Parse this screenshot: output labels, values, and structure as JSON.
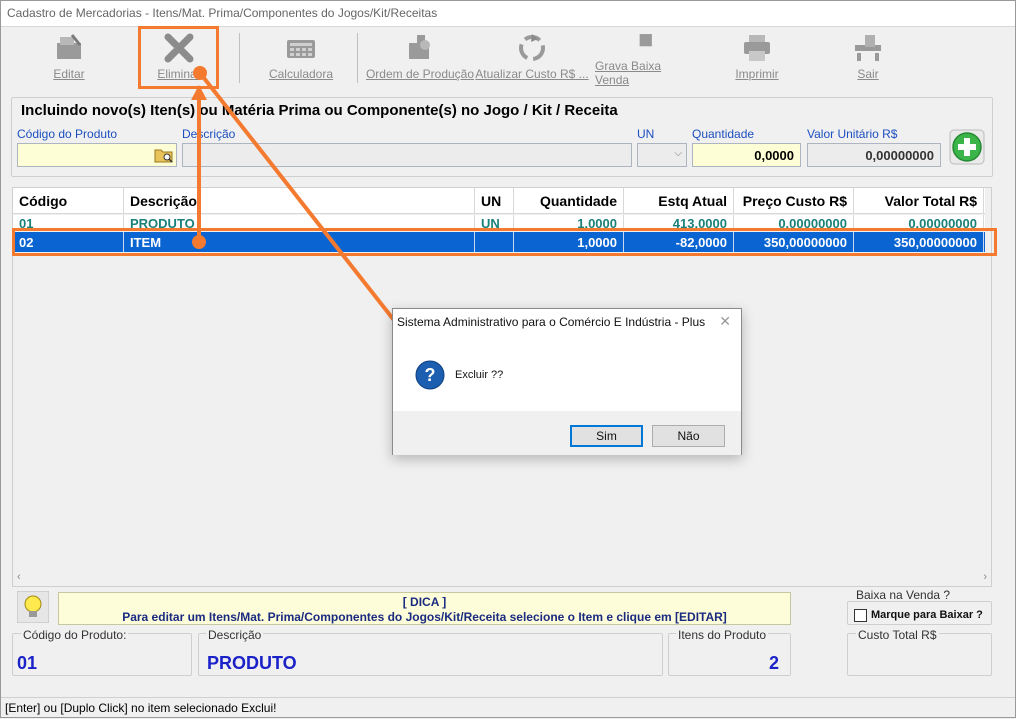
{
  "window": {
    "title": "Cadastro de Mercadorias - Itens/Mat. Prima/Componentes do Jogos/Kit/Receitas"
  },
  "toolbar": {
    "editar": "Editar",
    "eliminar": "Eliminar",
    "calculadora": "Calculadora",
    "ordem_producao": "Ordem de Produção",
    "atualizar_custo": "Atualizar Custo R$ ...",
    "grava_baixa": "Grava Baixa Venda",
    "imprimir": "Imprimir",
    "sair": "Sair"
  },
  "form": {
    "panel_title": "Incluindo novo(s) Iten(s) ou Matéria Prima ou Componente(s) no Jogo / Kit / Receita",
    "codigo_label": "Código do Produto",
    "descricao_label": "Descrição",
    "un_label": "UN",
    "quantidade_label": "Quantidade",
    "quantidade_value": "0,0000",
    "valor_unitario_label": "Valor Unitário R$",
    "valor_unitario_value": "0,00000000"
  },
  "grid": {
    "headers": [
      "Código",
      "Descrição",
      "UN",
      "Quantidade",
      "Estq Atual",
      "Preço Custo R$",
      "Valor Total R$"
    ],
    "rows": [
      [
        "01",
        "PRODUTO",
        "UN",
        "1,0000",
        "413,0000",
        "0,00000000",
        "0,00000000"
      ],
      [
        "02",
        "ITEM",
        "",
        "1,0000",
        "-82,0000",
        "350,00000000",
        "350,00000000"
      ]
    ]
  },
  "dica": {
    "title": "[ DICA ]",
    "text": "Para editar um Itens/Mat. Prima/Componentes do Jogos/Kit/Receita selecione o Item e clique em [EDITAR]"
  },
  "footer": {
    "baixa_label": "Baixa na Venda ?",
    "marque_label": "Marque para Baixar ?",
    "codigo_label": "Código do Produto:",
    "codigo_value": "01",
    "descricao_label": "Descrição",
    "descricao_value": "PRODUTO",
    "itens_label": "Itens do Produto",
    "itens_value": "2",
    "custo_total_label": "Custo Total R$"
  },
  "status": {
    "text": "[Enter] ou [Duplo Click] no item selecionado Exclui!"
  },
  "dialog": {
    "title": "Sistema Administrativo para o Comércio E Indústria - Plus",
    "message": "Excluir  ??",
    "yes": "Sim",
    "no": "Não"
  },
  "colors": {
    "accent_annotation": "#f47a30",
    "selection": "#0a64d2",
    "label_blue": "#1c4fbf",
    "value_blue": "#1a22c8"
  }
}
